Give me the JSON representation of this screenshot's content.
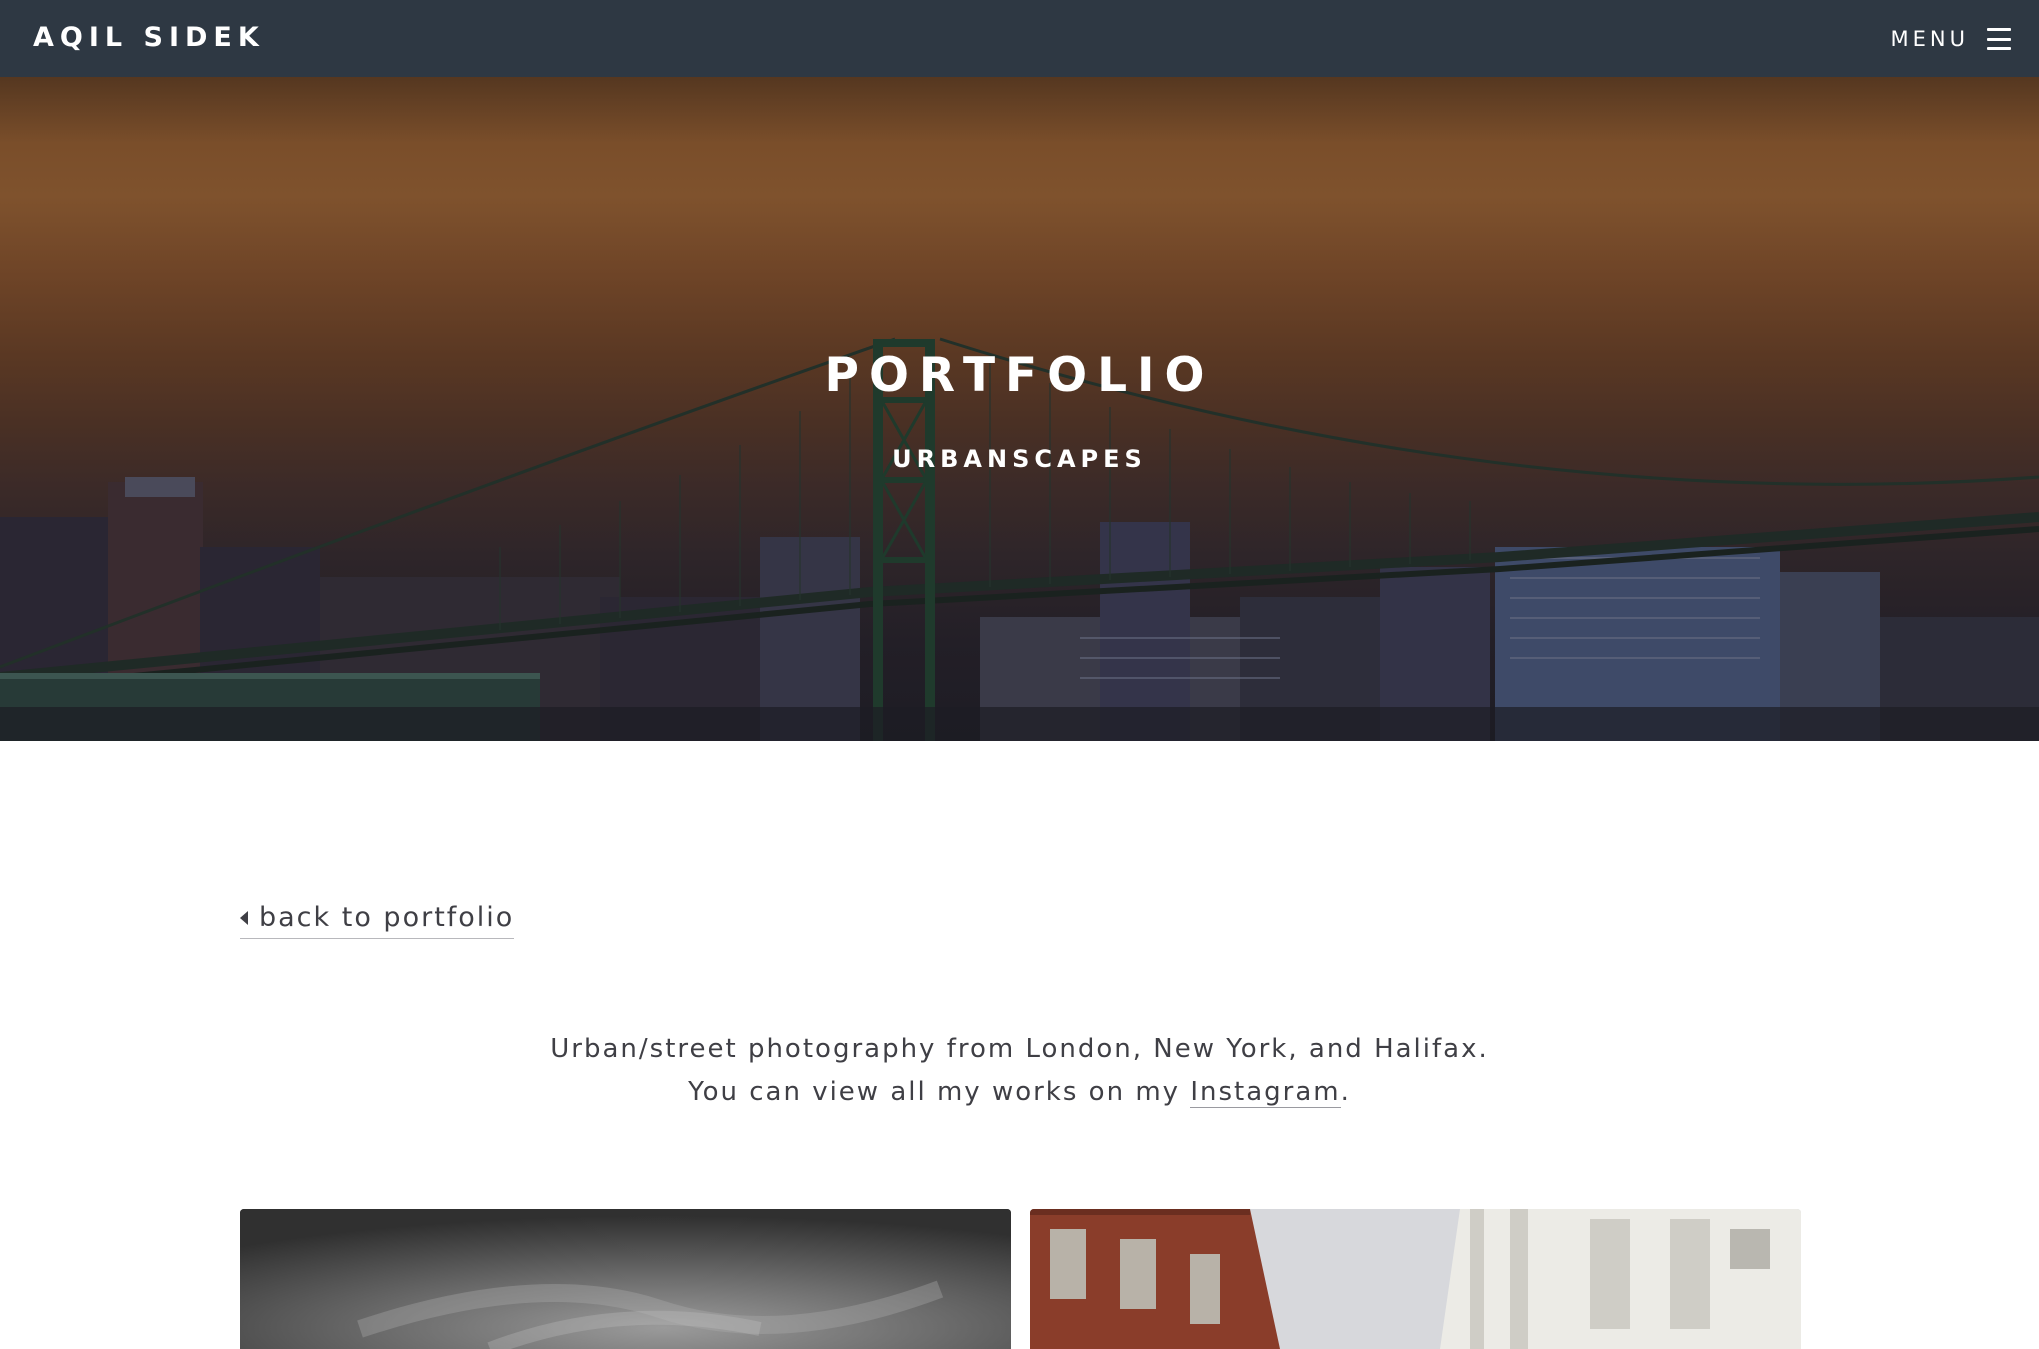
{
  "navbar": {
    "brand": "AQIL SIDEK",
    "menu_label": "MENU",
    "menu_icon": "hamburger-icon"
  },
  "hero": {
    "title": "PORTFOLIO",
    "subtitle": "URBANSCAPES",
    "background_image": "suspension bridge over harbour at dusk with city skyline"
  },
  "content": {
    "back_link": {
      "icon": "caret-left-icon",
      "label": "back to portfolio"
    },
    "intro": {
      "line1": "Urban/street photography from London, New York, and Halifax.",
      "line2_prefix": "You can view all my works on my ",
      "line2_link": "Instagram",
      "line2_suffix": "."
    }
  },
  "gallery": {
    "items": [
      {
        "alt": "black and white long exposure sky photo"
      },
      {
        "alt": "street view between brick and white buildings"
      }
    ]
  },
  "colors": {
    "navbar_bg": "#2e3843",
    "text": "#3f3f45",
    "hero_text": "#ffffff"
  }
}
